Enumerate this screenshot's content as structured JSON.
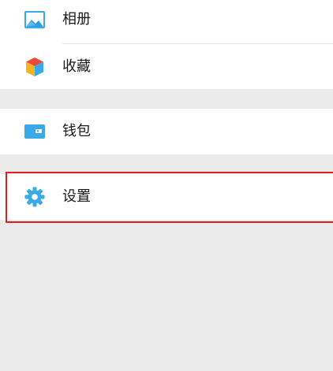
{
  "menu": {
    "group1": [
      {
        "label": "相册",
        "icon": "album-icon"
      },
      {
        "label": "收藏",
        "icon": "favorites-icon"
      }
    ],
    "group2": [
      {
        "label": "钱包",
        "icon": "wallet-icon"
      }
    ],
    "group3": [
      {
        "label": "设置",
        "icon": "gear-icon"
      }
    ]
  },
  "colors": {
    "background": "#ebebeb",
    "card": "#ffffff",
    "accent_blue": "#3aa9e8",
    "highlight_red": "#e02020"
  }
}
